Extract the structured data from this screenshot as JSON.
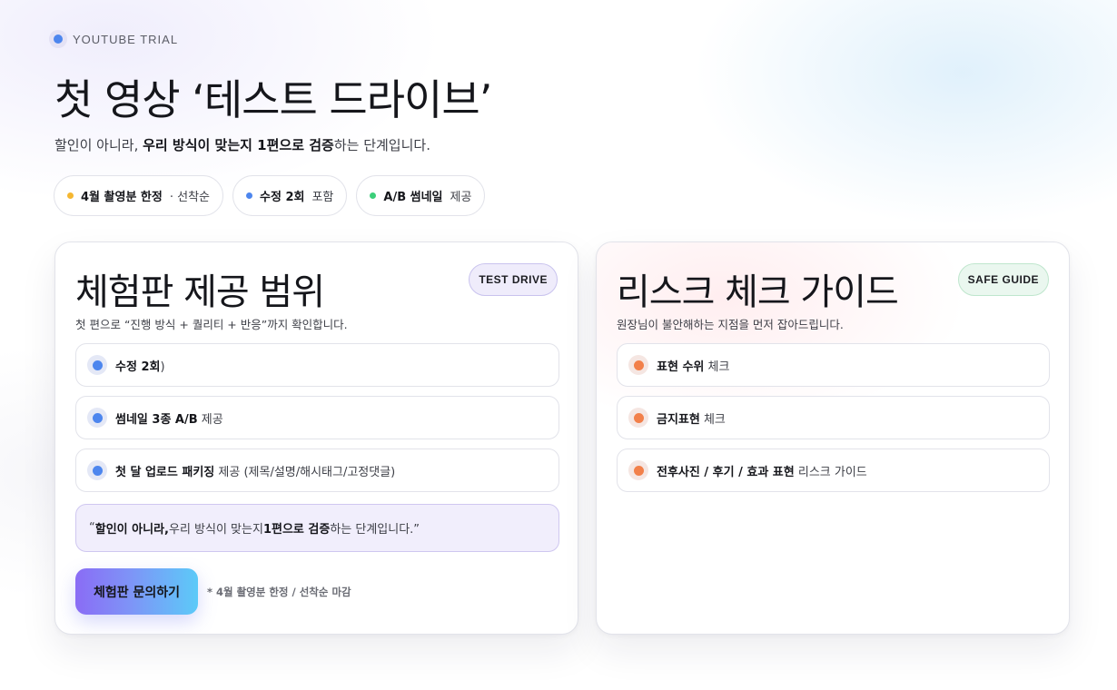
{
  "eyebrow": {
    "label": "YOUTUBE TRIAL",
    "icon": "dot-icon",
    "color": "#4d86ee"
  },
  "hero": {
    "title": "첫 영상 ‘테스트 드라이브’",
    "subtitle_pre": "할인이 아니라, ",
    "subtitle_bold": "우리 방식이 맞는지 1편으로 검증",
    "subtitle_post": "하는 단계입니다."
  },
  "chips": [
    {
      "bold": "4월 촬영분 한정",
      "text": "· 선착순",
      "color": "#f5b731"
    },
    {
      "bold": "수정 2회",
      "text": "포함",
      "color": "#4d86ee"
    },
    {
      "bold": "A/B 썸네일",
      "text": "제공",
      "color": "#3ccf7a"
    }
  ],
  "trial_card": {
    "title": "체험판 제공 범위",
    "badge": "TEST DRIVE",
    "description": "첫 편으로 “진행 방식 + 퀄리티 + 반응”까지 확인합니다.",
    "items": [
      {
        "bold": "수정 2회",
        "text": ")"
      },
      {
        "bold": "썸네일 3종 A/B",
        "text": " 제공"
      },
      {
        "bold": "첫 달 업로드 패키징",
        "text": " 제공 (제목/설명/해시태그/고정댓글)"
      }
    ],
    "quote": {
      "p1": "“",
      "b1": "할인이 아니라,",
      "p2": " 우리 방식이 맞는지 ",
      "b2": "1편으로 검증",
      "p3": "하는 단계입니다.”"
    },
    "cta_label": "체험판 문의하기",
    "cta_note": "* 4월 촬영분 한정 / 선착순 마감"
  },
  "risk_card": {
    "title": "리스크 체크 가이드",
    "badge": "SAFE GUIDE",
    "description": "원장님이 불안해하는 지점을 먼저 잡아드립니다.",
    "items": [
      {
        "bold": "표현 수위",
        "text": " 체크"
      },
      {
        "bold": "금지표현",
        "text": " 체크"
      },
      {
        "bold": "전후사진 / 후기 / 효과 표현",
        "text": " 리스크 가이드"
      }
    ]
  }
}
